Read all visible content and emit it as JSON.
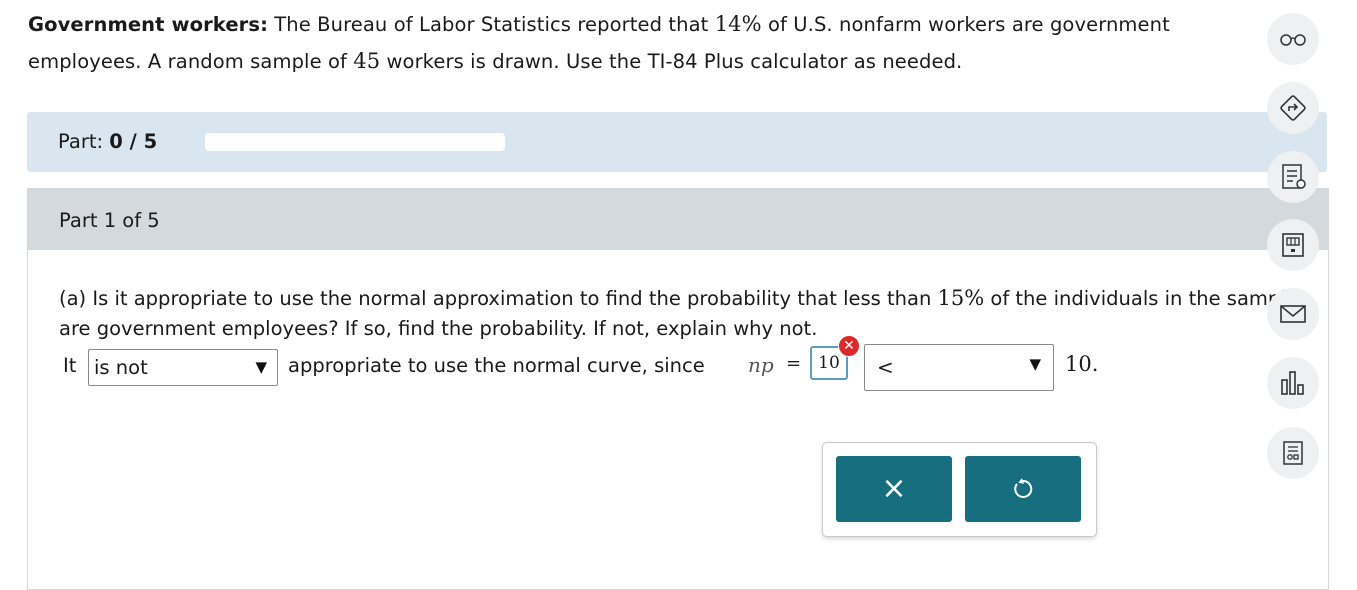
{
  "problem": {
    "title": "Government workers:",
    "text_1": " The Bureau of Labor Statistics reported that ",
    "percent_1": "14%",
    "text_2": " of U.S. nonfarm workers are government employees. A random sample of ",
    "sample_size": "45",
    "text_3": " workers is drawn. Use the TI-84 Plus calculator as needed."
  },
  "progress": {
    "label": "Part:",
    "current": "0",
    "separator": " / ",
    "total": "5",
    "fraction": 0
  },
  "part": {
    "title": "Part 1 of 5",
    "question_1": "(a) Is it appropriate to use the normal approximation to find the probability that less than ",
    "question_percent": "15%",
    "question_2": " of the individuals in the sample are government employees? If so, find the probability. If not, explain why not."
  },
  "answer": {
    "lead": "It",
    "dropdown_1_value": "is not",
    "middle": "appropriate to use the normal curve, since",
    "np_symbol": "np",
    "equals": "=",
    "np_input_value": "10",
    "dropdown_2_value": "<",
    "tail_value": "10."
  },
  "buttons": {
    "clear_icon": "×",
    "undo_icon": "undo-icon"
  },
  "toolbar": {
    "items": [
      "glasses-icon",
      "direction-icon",
      "guided-solution-icon",
      "calculator-icon",
      "mail-icon",
      "chart-icon",
      "worksheet-icon"
    ]
  }
}
